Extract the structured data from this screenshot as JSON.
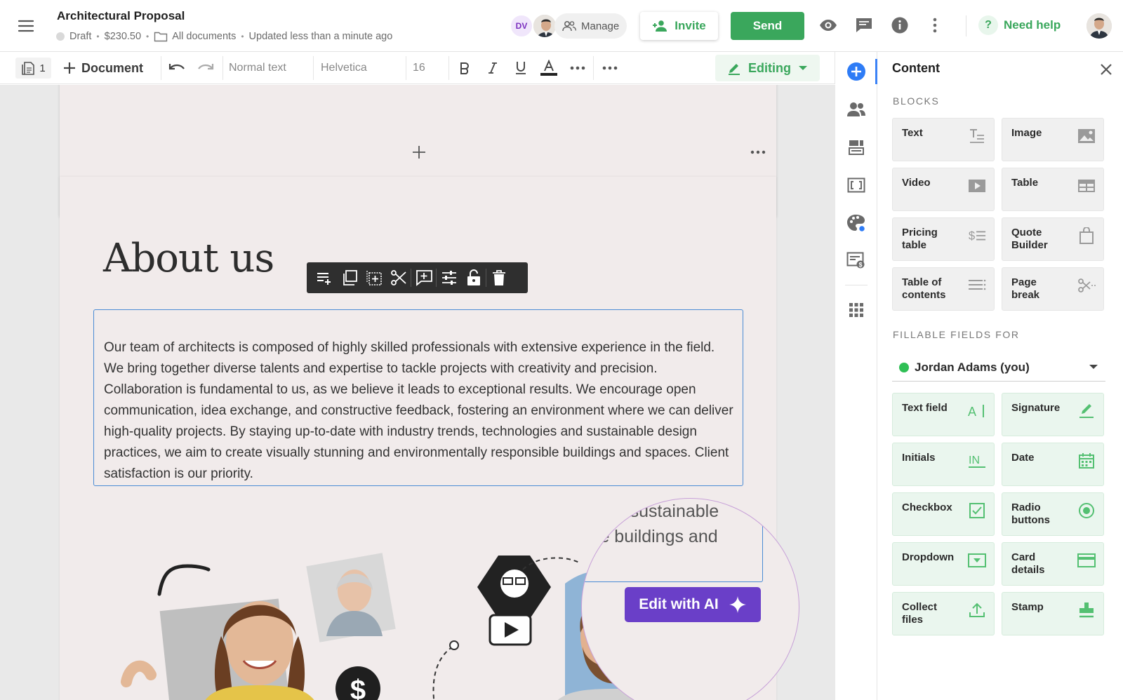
{
  "header": {
    "title": "Architectural Proposal",
    "status": "Draft",
    "price": "$230.50",
    "folder": "All documents",
    "updated": "Updated less than a minute ago",
    "avatar_initials": "DV",
    "manage_label": "Manage",
    "invite_label": "Invite",
    "send_label": "Send",
    "help_label": "Need help"
  },
  "toolbar": {
    "page_count": "1",
    "document_label": "Document",
    "text_style": "Normal text",
    "font": "Helvetica",
    "font_size": "16",
    "mode_label": "Editing"
  },
  "document": {
    "heading": "About us",
    "body": "Our team of architects is composed of highly skilled professionals with extensive experience in the field. We bring together diverse talents and expertise to tackle projects with creativity and precision. Collaboration is fundamental to us, as we believe it leads to exceptional results. We encourage open communication, idea exchange, and constructive feedback, fostering an environment where we can deliver high-quality projects. By staying up-to-date with industry trends, technologies and sustainable design practices, we aim to create visually stunning and environmentally responsible buildings and spaces. Client satisfaction is our priority.",
    "magnified_line1": "and sustainable",
    "magnified_line2": "ble buildings and",
    "ai_button_label": "Edit with AI"
  },
  "panel": {
    "title": "Content",
    "blocks_label": "BLOCKS",
    "blocks": [
      {
        "label": "Text",
        "icon": "text-block-icon"
      },
      {
        "label": "Image",
        "icon": "image-block-icon"
      },
      {
        "label": "Video",
        "icon": "video-block-icon"
      },
      {
        "label": "Table",
        "icon": "table-block-icon"
      },
      {
        "label": "Pricing table",
        "icon": "pricing-table-icon"
      },
      {
        "label": "Quote Builder",
        "icon": "quote-builder-icon"
      },
      {
        "label": "Table of contents",
        "icon": "toc-icon"
      },
      {
        "label": "Page break",
        "icon": "page-break-icon"
      }
    ],
    "fields_label": "FILLABLE FIELDS FOR",
    "assignee": "Jordan Adams (you)",
    "fields": [
      {
        "label": "Text field",
        "icon": "text-field-icon"
      },
      {
        "label": "Signature",
        "icon": "signature-icon"
      },
      {
        "label": "Initials",
        "icon": "initials-icon"
      },
      {
        "label": "Date",
        "icon": "calendar-icon"
      },
      {
        "label": "Checkbox",
        "icon": "checkbox-icon"
      },
      {
        "label": "Radio buttons",
        "icon": "radio-icon"
      },
      {
        "label": "Dropdown",
        "icon": "dropdown-icon"
      },
      {
        "label": "Card details",
        "icon": "card-icon"
      },
      {
        "label": "Collect files",
        "icon": "upload-icon"
      },
      {
        "label": "Stamp",
        "icon": "stamp-icon"
      }
    ]
  },
  "colors": {
    "brand_green": "#3aa75c",
    "ai_purple": "#6a3fc8",
    "selection_blue": "#4a8bd4",
    "field_bg": "#eaf6ee"
  }
}
